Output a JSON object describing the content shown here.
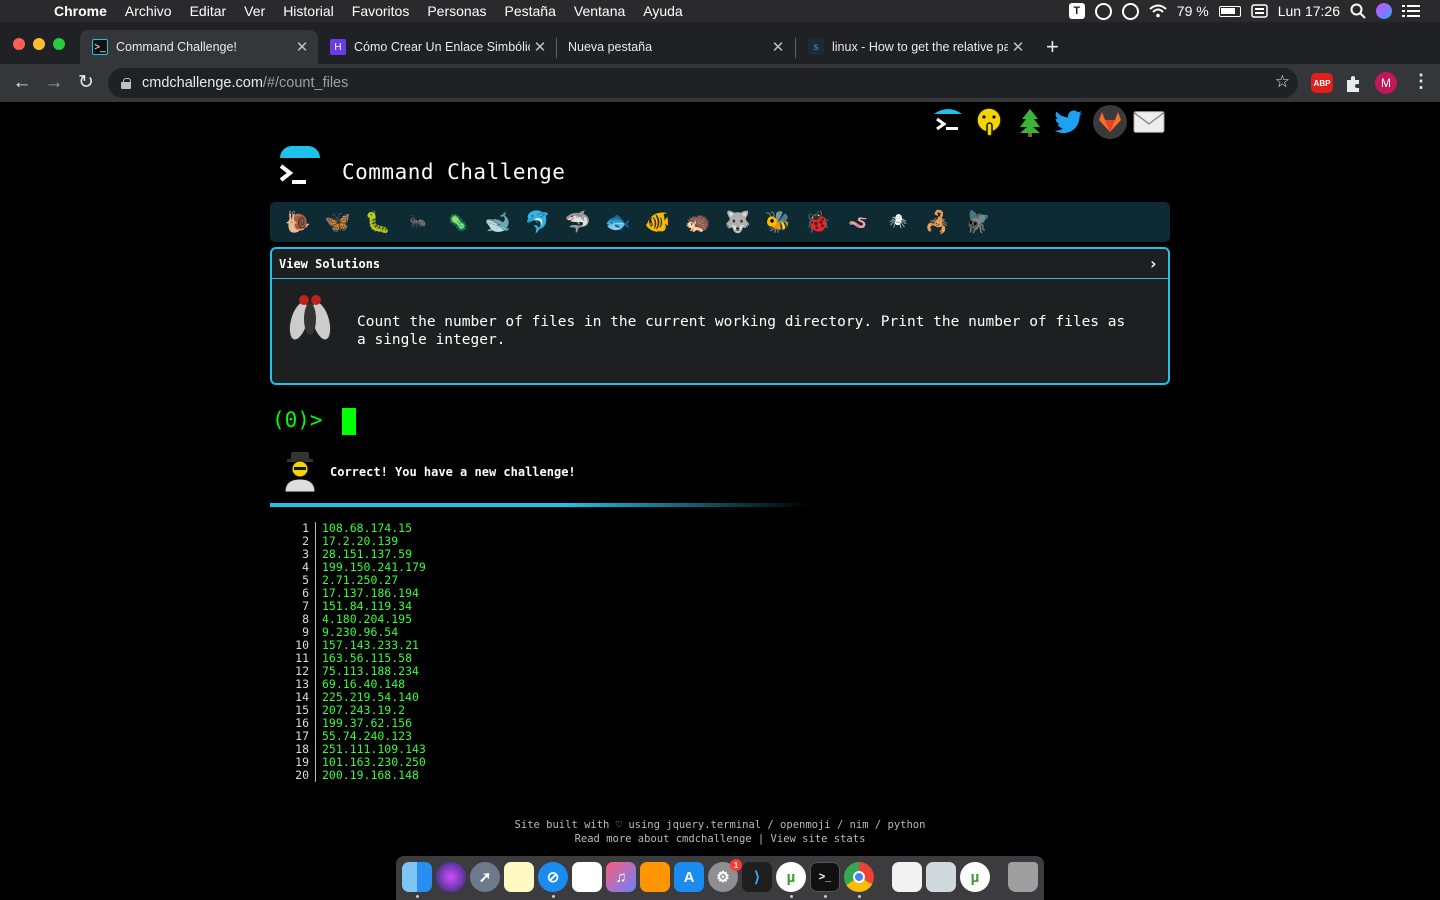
{
  "menubar": {
    "apple": "",
    "items": [
      "Chrome",
      "Archivo",
      "Editar",
      "Ver",
      "Historial",
      "Favoritos",
      "Personas",
      "Pestaña",
      "Ventana",
      "Ayuda"
    ],
    "battery": "79 %",
    "clock": "Lun 17:26",
    "t_icon": "T"
  },
  "tabs": [
    {
      "title": "Command Challenge!",
      "favicon": "terminal-icon",
      "active": true
    },
    {
      "title": "Cómo Crear Un Enlace Simbólico",
      "favicon": "hostinger-icon",
      "active": false
    },
    {
      "title": "Nueva pestaña",
      "favicon": "",
      "active": false
    },
    {
      "title": "linux - How to get the relative path",
      "favicon": "superuser-icon",
      "active": false
    }
  ],
  "toolbar": {
    "url_host": "cmdchallenge.com",
    "url_path": "/#/count_files",
    "profile_initial": "M",
    "abp_label": "ABP"
  },
  "page": {
    "title": "Command Challenge",
    "view_solutions": "View Solutions",
    "description": "Count the number of files in the current working directory. Print the number of files as a single integer.",
    "prompt": "(0)>",
    "message": "Correct! You have a new challenge!",
    "output": [
      {
        "n": "1",
        "v": "108.68.174.15"
      },
      {
        "n": "2",
        "v": "17.2.20.139"
      },
      {
        "n": "3",
        "v": "28.151.137.59"
      },
      {
        "n": "4",
        "v": "199.150.241.179"
      },
      {
        "n": "5",
        "v": "2.71.250.27"
      },
      {
        "n": "6",
        "v": "17.137.186.194"
      },
      {
        "n": "7",
        "v": "151.84.119.34"
      },
      {
        "n": "8",
        "v": "4.180.204.195"
      },
      {
        "n": "9",
        "v": "9.230.96.54"
      },
      {
        "n": "10",
        "v": "157.143.233.21"
      },
      {
        "n": "11",
        "v": "163.56.115.58"
      },
      {
        "n": "12",
        "v": "75.113.188.234"
      },
      {
        "n": "13",
        "v": "69.16.40.148"
      },
      {
        "n": "14",
        "v": "225.219.54.140"
      },
      {
        "n": "15",
        "v": "207.243.19.2"
      },
      {
        "n": "16",
        "v": "199.37.62.156"
      },
      {
        "n": "17",
        "v": "55.74.240.123"
      },
      {
        "n": "18",
        "v": "251.111.109.143"
      },
      {
        "n": "19",
        "v": "101.163.230.250"
      },
      {
        "n": "20",
        "v": "200.19.168.148"
      }
    ],
    "footer_line1": "Site built with ♡ using jquery.terminal / openmoji / nim / python",
    "footer_line2": "Read more about cmdchallenge | View site stats"
  },
  "challenge_icons": [
    "snail-icon",
    "butterfly-icon",
    "caterpillar-icon",
    "ant-icon",
    "microbe-icon",
    "whale-icon",
    "dolphin-icon",
    "shark-icon",
    "fish-icon",
    "tropical-fish-icon",
    "hedgehog-icon",
    "wolf-icon",
    "bee-icon",
    "ladybug-icon",
    "worm-icon",
    "spider-icon",
    "scorpion-icon",
    "fly-icon"
  ],
  "colors": {
    "accent": "#1ec1e9",
    "prompt_green": "#00ff00",
    "output_green": "#33ff33",
    "panel_bg": "#1e1f21",
    "challenge_bar_bg": "#0e2a33"
  },
  "dock": {
    "badge": "1"
  }
}
